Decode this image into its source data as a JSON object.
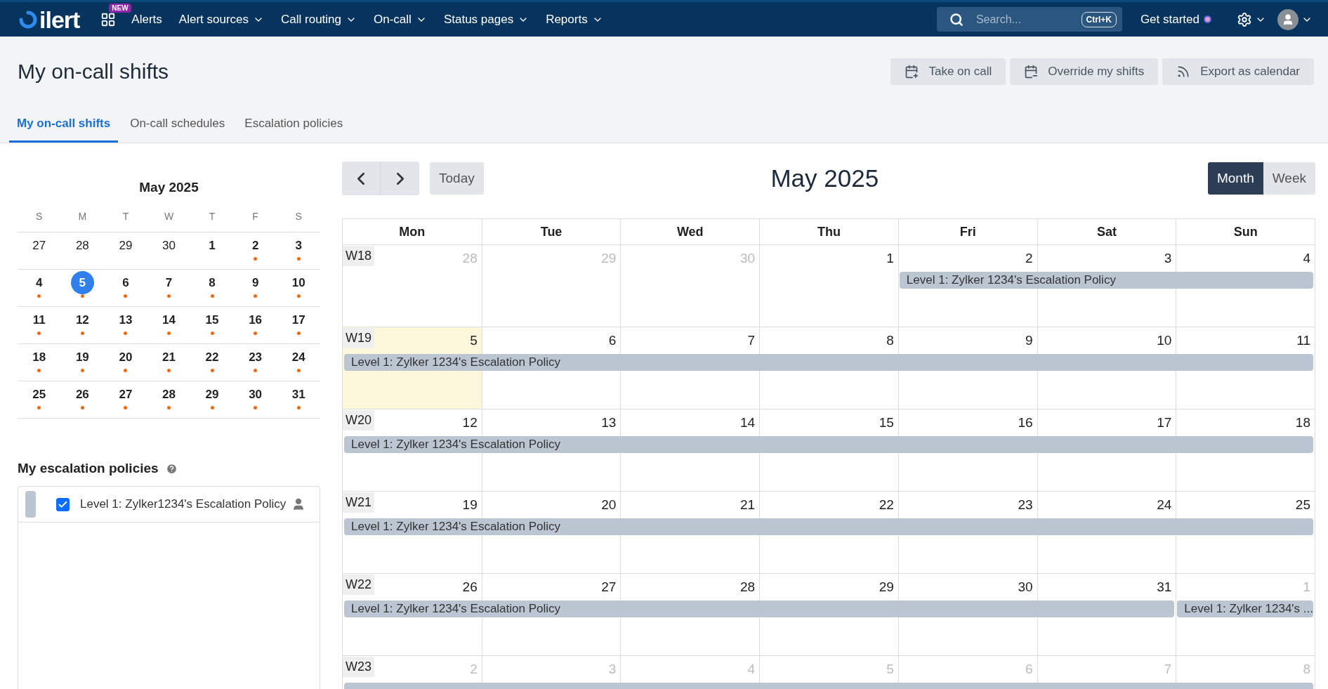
{
  "nav": {
    "logo": "ilert",
    "new_badge": "NEW",
    "items": [
      {
        "label": "Alerts",
        "dropdown": false
      },
      {
        "label": "Alert sources",
        "dropdown": true
      },
      {
        "label": "Call routing",
        "dropdown": true
      },
      {
        "label": "On-call",
        "dropdown": true
      },
      {
        "label": "Status pages",
        "dropdown": true
      },
      {
        "label": "Reports",
        "dropdown": true
      }
    ],
    "search": {
      "placeholder": "Search...",
      "shortcut": "Ctrl+K"
    },
    "get_started": "Get started"
  },
  "page": {
    "title": "My on-call shifts",
    "actions": [
      "Take on call",
      "Override my shifts",
      "Export as calendar"
    ]
  },
  "tabs": [
    {
      "label": "My on-call shifts",
      "selected": true
    },
    {
      "label": "On-call schedules",
      "selected": false
    },
    {
      "label": "Escalation policies",
      "selected": false
    }
  ],
  "mini_calendar": {
    "title": "May 2025",
    "weekdays": [
      "S",
      "M",
      "T",
      "W",
      "T",
      "F",
      "S"
    ],
    "weeks": [
      [
        {
          "day": "27",
          "outside": true,
          "shift": false,
          "selected": false
        },
        {
          "day": "28",
          "outside": true,
          "shift": false,
          "selected": false
        },
        {
          "day": "29",
          "outside": true,
          "shift": false,
          "selected": false
        },
        {
          "day": "30",
          "outside": true,
          "shift": false,
          "selected": false
        },
        {
          "day": "1",
          "outside": false,
          "shift": false,
          "selected": false
        },
        {
          "day": "2",
          "outside": false,
          "shift": true,
          "selected": false
        },
        {
          "day": "3",
          "outside": false,
          "shift": true,
          "selected": false
        }
      ],
      [
        {
          "day": "4",
          "outside": false,
          "shift": true,
          "selected": false
        },
        {
          "day": "5",
          "outside": false,
          "shift": true,
          "selected": true
        },
        {
          "day": "6",
          "outside": false,
          "shift": true,
          "selected": false
        },
        {
          "day": "7",
          "outside": false,
          "shift": true,
          "selected": false
        },
        {
          "day": "8",
          "outside": false,
          "shift": true,
          "selected": false
        },
        {
          "day": "9",
          "outside": false,
          "shift": true,
          "selected": false
        },
        {
          "day": "10",
          "outside": false,
          "shift": true,
          "selected": false
        }
      ],
      [
        {
          "day": "11",
          "outside": false,
          "shift": true,
          "selected": false
        },
        {
          "day": "12",
          "outside": false,
          "shift": true,
          "selected": false
        },
        {
          "day": "13",
          "outside": false,
          "shift": true,
          "selected": false
        },
        {
          "day": "14",
          "outside": false,
          "shift": true,
          "selected": false
        },
        {
          "day": "15",
          "outside": false,
          "shift": true,
          "selected": false
        },
        {
          "day": "16",
          "outside": false,
          "shift": true,
          "selected": false
        },
        {
          "day": "17",
          "outside": false,
          "shift": true,
          "selected": false
        }
      ],
      [
        {
          "day": "18",
          "outside": false,
          "shift": true,
          "selected": false
        },
        {
          "day": "19",
          "outside": false,
          "shift": true,
          "selected": false
        },
        {
          "day": "20",
          "outside": false,
          "shift": true,
          "selected": false
        },
        {
          "day": "21",
          "outside": false,
          "shift": true,
          "selected": false
        },
        {
          "day": "22",
          "outside": false,
          "shift": true,
          "selected": false
        },
        {
          "day": "23",
          "outside": false,
          "shift": true,
          "selected": false
        },
        {
          "day": "24",
          "outside": false,
          "shift": true,
          "selected": false
        }
      ],
      [
        {
          "day": "25",
          "outside": false,
          "shift": true,
          "selected": false
        },
        {
          "day": "26",
          "outside": false,
          "shift": true,
          "selected": false
        },
        {
          "day": "27",
          "outside": false,
          "shift": true,
          "selected": false
        },
        {
          "day": "28",
          "outside": false,
          "shift": true,
          "selected": false
        },
        {
          "day": "29",
          "outside": false,
          "shift": true,
          "selected": false
        },
        {
          "day": "30",
          "outside": false,
          "shift": true,
          "selected": false
        },
        {
          "day": "31",
          "outside": false,
          "shift": true,
          "selected": false
        }
      ]
    ]
  },
  "policies": {
    "title": "My escalation policies",
    "items": [
      {
        "label": "Level 1: Zylker1234's Escalation Policy",
        "checked": true,
        "color": "#bcc6d3"
      }
    ]
  },
  "calendar": {
    "today": "Today",
    "title": "May 2025",
    "views": [
      {
        "label": "Month",
        "selected": true
      },
      {
        "label": "Week",
        "selected": false
      }
    ],
    "weekdays": [
      "Mon",
      "Tue",
      "Wed",
      "Thu",
      "Fri",
      "Sat",
      "Sun"
    ],
    "weeks": [
      {
        "label": "W18",
        "days": [
          {
            "day": "28",
            "outside": true,
            "today": false,
            "on_shift": false
          },
          {
            "day": "29",
            "outside": true,
            "today": false,
            "on_shift": false
          },
          {
            "day": "30",
            "outside": true,
            "today": false,
            "on_shift": false
          },
          {
            "day": "1",
            "outside": false,
            "today": false,
            "on_shift": false
          },
          {
            "day": "2",
            "outside": false,
            "today": false,
            "on_shift": true,
            "event": "Level 1: Zylker 1234's Escalation Policy"
          },
          {
            "day": "3",
            "outside": false,
            "today": false,
            "on_shift": true
          },
          {
            "day": "4",
            "outside": false,
            "today": false,
            "on_shift": true
          }
        ]
      },
      {
        "label": "W19",
        "days": [
          {
            "day": "5",
            "outside": false,
            "today": true,
            "on_shift": true,
            "event": "Level 1: Zylker 1234's Escalation Policy"
          },
          {
            "day": "6",
            "outside": false,
            "today": false,
            "on_shift": true
          },
          {
            "day": "7",
            "outside": false,
            "today": false,
            "on_shift": true
          },
          {
            "day": "8",
            "outside": false,
            "today": false,
            "on_shift": true
          },
          {
            "day": "9",
            "outside": false,
            "today": false,
            "on_shift": true
          },
          {
            "day": "10",
            "outside": false,
            "today": false,
            "on_shift": true
          },
          {
            "day": "11",
            "outside": false,
            "today": false,
            "on_shift": true
          }
        ]
      },
      {
        "label": "W20",
        "days": [
          {
            "day": "12",
            "outside": false,
            "today": false,
            "on_shift": true,
            "event": "Level 1: Zylker 1234's Escalation Policy"
          },
          {
            "day": "13",
            "outside": false,
            "today": false,
            "on_shift": true
          },
          {
            "day": "14",
            "outside": false,
            "today": false,
            "on_shift": true
          },
          {
            "day": "15",
            "outside": false,
            "today": false,
            "on_shift": true
          },
          {
            "day": "16",
            "outside": false,
            "today": false,
            "on_shift": true
          },
          {
            "day": "17",
            "outside": false,
            "today": false,
            "on_shift": true
          },
          {
            "day": "18",
            "outside": false,
            "today": false,
            "on_shift": true
          }
        ]
      },
      {
        "label": "W21",
        "days": [
          {
            "day": "19",
            "outside": false,
            "today": false,
            "on_shift": true,
            "event": "Level 1: Zylker 1234's Escalation Policy"
          },
          {
            "day": "20",
            "outside": false,
            "today": false,
            "on_shift": true
          },
          {
            "day": "21",
            "outside": false,
            "today": false,
            "on_shift": true
          },
          {
            "day": "22",
            "outside": false,
            "today": false,
            "on_shift": true
          },
          {
            "day": "23",
            "outside": false,
            "today": false,
            "on_shift": true
          },
          {
            "day": "24",
            "outside": false,
            "today": false,
            "on_shift": true
          },
          {
            "day": "25",
            "outside": false,
            "today": false,
            "on_shift": true
          }
        ]
      },
      {
        "label": "W22",
        "days": [
          {
            "day": "26",
            "outside": false,
            "today": false,
            "on_shift": true,
            "event": "Level 1: Zylker 1234's Escalation Policy"
          },
          {
            "day": "27",
            "outside": false,
            "today": false,
            "on_shift": true
          },
          {
            "day": "28",
            "outside": false,
            "today": false,
            "on_shift": true
          },
          {
            "day": "29",
            "outside": false,
            "today": false,
            "on_shift": true
          },
          {
            "day": "30",
            "outside": false,
            "today": false,
            "on_shift": true
          },
          {
            "day": "31",
            "outside": false,
            "today": false,
            "on_shift": true
          },
          {
            "day": "1",
            "outside": true,
            "today": false,
            "on_shift": true,
            "event": "Level 1: Zylker 1234's ..."
          }
        ]
      },
      {
        "label": "W23",
        "days": [
          {
            "day": "2",
            "outside": true,
            "today": false,
            "on_shift": true
          },
          {
            "day": "3",
            "outside": true,
            "today": false,
            "on_shift": true
          },
          {
            "day": "4",
            "outside": true,
            "today": false,
            "on_shift": true
          },
          {
            "day": "5",
            "outside": true,
            "today": false,
            "on_shift": true
          },
          {
            "day": "6",
            "outside": true,
            "today": false,
            "on_shift": true
          },
          {
            "day": "7",
            "outside": true,
            "today": false,
            "on_shift": true
          },
          {
            "day": "8",
            "outside": true,
            "today": false,
            "on_shift": true
          }
        ]
      }
    ]
  }
}
